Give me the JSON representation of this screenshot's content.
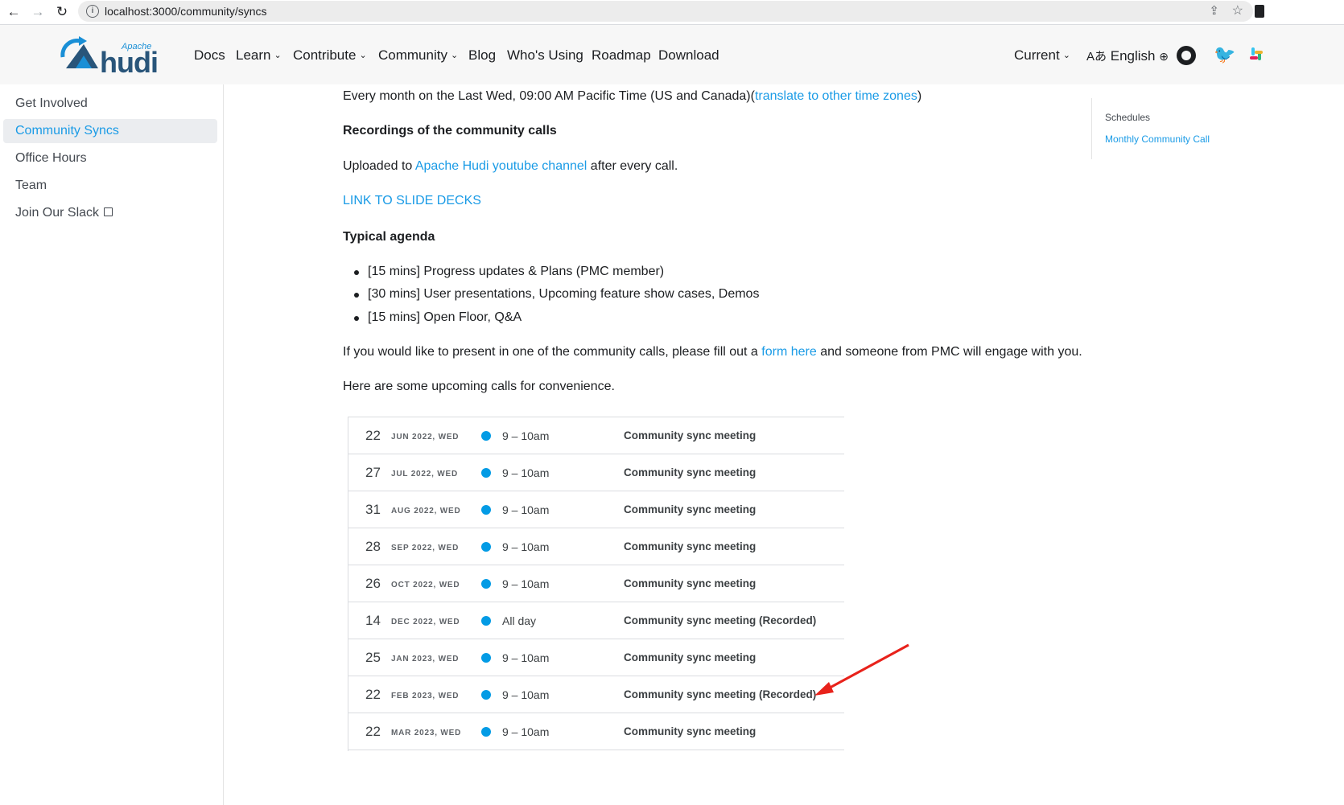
{
  "browser": {
    "url": "localhost:3000/community/syncs"
  },
  "navbar": {
    "logo_small": "Apache",
    "logo_word": "hudi",
    "items": [
      {
        "label": "Docs"
      },
      {
        "label": "Learn"
      },
      {
        "label": "Contribute"
      },
      {
        "label": "Community"
      },
      {
        "label": "Blog"
      },
      {
        "label": "Who's Using"
      },
      {
        "label": "Roadmap"
      },
      {
        "label": "Download"
      }
    ],
    "version": "Current",
    "language": "English"
  },
  "sidebar": {
    "items": [
      {
        "label": "Get Involved"
      },
      {
        "label": "Community Syncs"
      },
      {
        "label": "Office Hours"
      },
      {
        "label": "Team"
      },
      {
        "label": "Join Our Slack"
      }
    ]
  },
  "main": {
    "schedule_text": "Every month on the Last Wed, 09:00 AM Pacific Time (US and Canada)(",
    "schedule_link": "translate to other time zones",
    "schedule_close": ")",
    "recordings_heading": "Recordings of the community calls",
    "uploaded_prefix": "Uploaded to ",
    "uploaded_link": "Apache Hudi youtube channel",
    "uploaded_suffix": " after every call.",
    "slides_link": "LINK TO SLIDE DECKS",
    "agenda_heading": "Typical agenda",
    "agenda": [
      "[15 mins] Progress updates & Plans (PMC member)",
      "[30 mins] User presentations, Upcoming feature show cases, Demos",
      "[15 mins] Open Floor, Q&A"
    ],
    "present_prefix": "If you would like to present in one of the community calls, please fill out a ",
    "present_link": "form here",
    "present_suffix": " and someone from PMC will engage with you.",
    "upcoming_text": "Here are some upcoming calls for convenience."
  },
  "calendar": {
    "rows": [
      {
        "day": "22",
        "month": "JUN 2022, WED",
        "time": "9 – 10am",
        "title": "Community sync meeting"
      },
      {
        "day": "27",
        "month": "JUL 2022, WED",
        "time": "9 – 10am",
        "title": "Community sync meeting"
      },
      {
        "day": "31",
        "month": "AUG 2022, WED",
        "time": "9 – 10am",
        "title": "Community sync meeting"
      },
      {
        "day": "28",
        "month": "SEP 2022, WED",
        "time": "9 – 10am",
        "title": "Community sync meeting"
      },
      {
        "day": "26",
        "month": "OCT 2022, WED",
        "time": "9 – 10am",
        "title": "Community sync meeting"
      },
      {
        "day": "14",
        "month": "DEC 2022, WED",
        "time": "All day",
        "title": "Community sync meeting (Recorded)"
      },
      {
        "day": "25",
        "month": "JAN 2023, WED",
        "time": "9 – 10am",
        "title": "Community sync meeting"
      },
      {
        "day": "22",
        "month": "FEB 2023, WED",
        "time": "9 – 10am",
        "title": "Community sync meeting (Recorded)"
      },
      {
        "day": "22",
        "month": "MAR 2023, WED",
        "time": "9 – 10am",
        "title": "Community sync meeting"
      }
    ],
    "dot_color": "#039be5"
  },
  "toc": {
    "items": [
      {
        "label": "Schedules"
      },
      {
        "label": "Monthly Community Call"
      }
    ]
  },
  "colors": {
    "accent": "#1a9be6",
    "annotation_arrow": "#e8221b"
  }
}
